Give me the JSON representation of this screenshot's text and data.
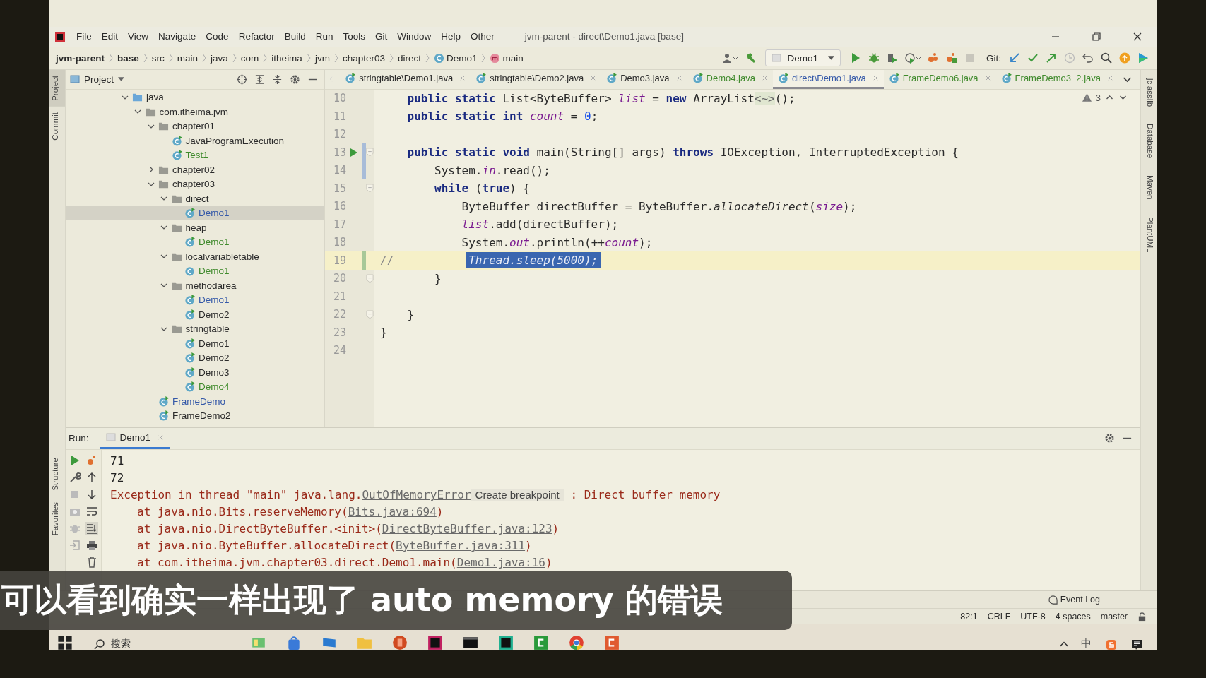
{
  "window": {
    "title": "jvm-parent - direct\\Demo1.java [base]"
  },
  "menu": [
    "File",
    "Edit",
    "View",
    "Navigate",
    "Code",
    "Refactor",
    "Build",
    "Run",
    "Tools",
    "Git",
    "Window",
    "Help",
    "Other"
  ],
  "breadcrumbs": [
    {
      "label": "jvm-parent",
      "kind": "text",
      "bold": true
    },
    {
      "label": "base",
      "kind": "text",
      "bold": true
    },
    {
      "label": "src",
      "kind": "text",
      "bold": false
    },
    {
      "label": "main",
      "kind": "text",
      "bold": false
    },
    {
      "label": "java",
      "kind": "text",
      "bold": false
    },
    {
      "label": "com",
      "kind": "text",
      "bold": false
    },
    {
      "label": "itheima",
      "kind": "text",
      "bold": false
    },
    {
      "label": "jvm",
      "kind": "text",
      "bold": false
    },
    {
      "label": "chapter03",
      "kind": "text",
      "bold": false
    },
    {
      "label": "direct",
      "kind": "text",
      "bold": false
    },
    {
      "label": "Demo1",
      "kind": "class",
      "bold": false
    },
    {
      "label": "main",
      "kind": "method",
      "bold": false
    }
  ],
  "toolbar": {
    "run_config": "Demo1",
    "git_label": "Git:"
  },
  "left_strip": {
    "top": [
      {
        "label": "Project",
        "selected": true
      },
      {
        "label": "Commit",
        "selected": false
      }
    ],
    "bottom": [
      {
        "label": "Structure",
        "selected": false
      },
      {
        "label": "Favorites",
        "selected": false
      }
    ]
  },
  "right_strip": [
    "jclasslib",
    "Database",
    "Maven",
    "PlantUML"
  ],
  "project_panel": {
    "title": "Project",
    "tree": [
      {
        "label": "java",
        "kind": "source_root",
        "expanded": true,
        "selected": false,
        "children": [
          {
            "label": "com.itheima.jvm",
            "kind": "package",
            "expanded": true,
            "selected": false,
            "children": [
              {
                "label": "chapter01",
                "kind": "package",
                "expanded": true,
                "selected": false,
                "children": [
                  {
                    "label": "JavaProgramExecution",
                    "kind": "class",
                    "runnable": true,
                    "selected": false,
                    "color": "#2b2b2b"
                  },
                  {
                    "label": "Test1",
                    "kind": "class",
                    "runnable": true,
                    "selected": false,
                    "color": "#3f8a2c"
                  }
                ]
              },
              {
                "label": "chapter02",
                "kind": "package",
                "expanded": false,
                "selected": false
              },
              {
                "label": "chapter03",
                "kind": "package",
                "expanded": true,
                "selected": false,
                "children": [
                  {
                    "label": "direct",
                    "kind": "package",
                    "expanded": true,
                    "selected": false,
                    "children": [
                      {
                        "label": "Demo1",
                        "kind": "class",
                        "runnable": true,
                        "selected": true,
                        "color": "#3458a8"
                      }
                    ]
                  },
                  {
                    "label": "heap",
                    "kind": "package",
                    "expanded": true,
                    "selected": false,
                    "children": [
                      {
                        "label": "Demo1",
                        "kind": "class",
                        "runnable": true,
                        "selected": false,
                        "color": "#3f8a2c"
                      }
                    ]
                  },
                  {
                    "label": "localvariabletable",
                    "kind": "package",
                    "expanded": true,
                    "selected": false,
                    "children": [
                      {
                        "label": "Demo1",
                        "kind": "class",
                        "runnable": false,
                        "selected": false,
                        "color": "#3f8a2c"
                      }
                    ]
                  },
                  {
                    "label": "methodarea",
                    "kind": "package",
                    "expanded": true,
                    "selected": false,
                    "children": [
                      {
                        "label": "Demo1",
                        "kind": "class",
                        "runnable": true,
                        "selected": false,
                        "color": "#3458a8"
                      },
                      {
                        "label": "Demo2",
                        "kind": "class",
                        "runnable": true,
                        "selected": false,
                        "color": "#2b2b2b"
                      }
                    ]
                  },
                  {
                    "label": "stringtable",
                    "kind": "package",
                    "expanded": true,
                    "selected": false,
                    "children": [
                      {
                        "label": "Demo1",
                        "kind": "class",
                        "runnable": true,
                        "selected": false,
                        "color": "#2b2b2b"
                      },
                      {
                        "label": "Demo2",
                        "kind": "class",
                        "runnable": true,
                        "selected": false,
                        "color": "#2b2b2b"
                      },
                      {
                        "label": "Demo3",
                        "kind": "class",
                        "runnable": true,
                        "selected": false,
                        "color": "#2b2b2b"
                      },
                      {
                        "label": "Demo4",
                        "kind": "class",
                        "runnable": true,
                        "selected": false,
                        "color": "#3f8a2c"
                      }
                    ]
                  }
                ]
              },
              {
                "label": "FrameDemo",
                "kind": "class",
                "runnable": true,
                "selected": false,
                "color": "#3458a8"
              },
              {
                "label": "FrameDemo2",
                "kind": "class",
                "runnable": true,
                "selected": false,
                "color": "#2b2b2b"
              }
            ]
          }
        ]
      }
    ]
  },
  "editor_tabs": [
    {
      "label": "stringtable\\Demo1.java",
      "selected": false,
      "color": "#2b2b2b"
    },
    {
      "label": "stringtable\\Demo2.java",
      "selected": false,
      "color": "#2b2b2b"
    },
    {
      "label": "Demo3.java",
      "selected": false,
      "color": "#2b2b2b"
    },
    {
      "label": "Demo4.java",
      "selected": false,
      "color": "#3f8a2c"
    },
    {
      "label": "direct\\Demo1.java",
      "selected": true,
      "color": "#3458a8"
    },
    {
      "label": "FrameDemo6.java",
      "selected": false,
      "color": "#3f8a2c"
    },
    {
      "label": "FrameDemo3_2.java",
      "selected": false,
      "color": "#3f8a2c"
    }
  ],
  "editor": {
    "warnings": "3",
    "lines": [
      {
        "number": "10",
        "tokens": [
          {
            "kind": "kw",
            "text": "    public static "
          },
          {
            "kind": "plain",
            "text": "List<ByteBuffer> "
          },
          {
            "kind": "field",
            "text": "list"
          },
          {
            "kind": "plain",
            "text": " = "
          },
          {
            "kind": "kw",
            "text": "new "
          },
          {
            "kind": "plain",
            "text": "ArrayList"
          },
          {
            "kind": "fold",
            "text": "<~>"
          },
          {
            "kind": "plain",
            "text": "();"
          }
        ]
      },
      {
        "number": "11",
        "tokens": [
          {
            "kind": "kw",
            "text": "    public static int "
          },
          {
            "kind": "field",
            "text": "count"
          },
          {
            "kind": "plain",
            "text": " = "
          },
          {
            "kind": "num",
            "text": "0"
          },
          {
            "kind": "plain",
            "text": ";"
          }
        ]
      },
      {
        "number": "12"
      },
      {
        "number": "13",
        "run": true,
        "fold": true,
        "color": "#a8bcd8",
        "tokens": [
          {
            "kind": "kw",
            "text": "    public static void "
          },
          {
            "kind": "plain",
            "text": "main(String[] args) "
          },
          {
            "kind": "kw",
            "text": "throws "
          },
          {
            "kind": "plain",
            "text": "IOException, InterruptedException {"
          }
        ]
      },
      {
        "number": "14",
        "color": "#a8bcd8",
        "tokens": [
          {
            "kind": "plain",
            "text": "        System."
          },
          {
            "kind": "field",
            "text": "in"
          },
          {
            "kind": "plain",
            "text": ".read();"
          }
        ]
      },
      {
        "number": "15",
        "fold": true,
        "tokens": [
          {
            "kind": "kw",
            "text": "        while "
          },
          {
            "kind": "plain",
            "text": "("
          },
          {
            "kind": "kw",
            "text": "true"
          },
          {
            "kind": "plain",
            "text": ") {"
          }
        ]
      },
      {
        "number": "16",
        "tokens": [
          {
            "kind": "plain",
            "text": "            ByteBuffer directBuffer = ByteBuffer."
          },
          {
            "kind": "method",
            "text": "allocateDirect"
          },
          {
            "kind": "plain",
            "text": "("
          },
          {
            "kind": "field",
            "text": "size"
          },
          {
            "kind": "plain",
            "text": ");"
          }
        ]
      },
      {
        "number": "17",
        "tokens": [
          {
            "kind": "field",
            "text": "            list"
          },
          {
            "kind": "plain",
            "text": ".add(directBuffer);"
          }
        ]
      },
      {
        "number": "18",
        "tokens": [
          {
            "kind": "plain",
            "text": "            System."
          },
          {
            "kind": "field",
            "text": "out"
          },
          {
            "kind": "plain",
            "text": ".println(++"
          },
          {
            "kind": "field",
            "text": "count"
          },
          {
            "kind": "plain",
            "text": ");"
          }
        ]
      },
      {
        "number": "19",
        "current": true,
        "color": "#a8c898",
        "tokens": [
          {
            "kind": "comment",
            "text": "//           "
          },
          {
            "kind": "selected",
            "text": "Thread.sleep(5000);"
          }
        ]
      },
      {
        "number": "20",
        "fold": true,
        "tokens": [
          {
            "kind": "plain",
            "text": "        }"
          }
        ]
      },
      {
        "number": "21"
      },
      {
        "number": "22",
        "fold": true,
        "tokens": [
          {
            "kind": "plain",
            "text": "    }"
          }
        ]
      },
      {
        "number": "23",
        "tokens": [
          {
            "kind": "plain",
            "text": "}"
          }
        ]
      },
      {
        "number": "24"
      }
    ]
  },
  "run_panel": {
    "label": "Run:",
    "tab": "Demo1",
    "output": [
      {
        "kind": "out",
        "segments": [
          {
            "kind": "text",
            "text": "71"
          }
        ]
      },
      {
        "kind": "out",
        "segments": [
          {
            "kind": "text",
            "text": "72"
          }
        ]
      },
      {
        "kind": "error",
        "segments": [
          {
            "kind": "text",
            "text": "Exception in thread \"main\" java.lang."
          },
          {
            "kind": "link",
            "text": "OutOfMemoryError"
          },
          {
            "kind": "hint",
            "text": "Create breakpoint"
          },
          {
            "kind": "text",
            "text": " : Direct buffer memory"
          }
        ]
      },
      {
        "kind": "stack",
        "segments": [
          {
            "kind": "text",
            "text": "at java.nio.Bits.reserveMemory("
          },
          {
            "kind": "link",
            "text": "Bits.java:694"
          },
          {
            "kind": "text",
            "text": ")"
          }
        ]
      },
      {
        "kind": "stack",
        "segments": [
          {
            "kind": "text",
            "text": "at java.nio.DirectByteBuffer.<init>("
          },
          {
            "kind": "link",
            "text": "DirectByteBuffer.java:123"
          },
          {
            "kind": "text",
            "text": ")"
          }
        ]
      },
      {
        "kind": "stack",
        "segments": [
          {
            "kind": "text",
            "text": "at java.nio.ByteBuffer.allocateDirect("
          },
          {
            "kind": "link",
            "text": "ByteBuffer.java:311"
          },
          {
            "kind": "text",
            "text": ")"
          }
        ]
      },
      {
        "kind": "stack",
        "segments": [
          {
            "kind": "text",
            "text": "at com.itheima.jvm.chapter03.direct.Demo1.main("
          },
          {
            "kind": "link",
            "text": "Demo1.java:16"
          },
          {
            "kind": "text",
            "text": ")"
          }
        ]
      }
    ]
  },
  "event_log": "Event Log",
  "status_bar": [
    "82:1",
    "CRLF",
    "UTF-8",
    "4 spaces",
    "master"
  ],
  "taskbar": {
    "search": "搜索",
    "ime": "中"
  },
  "subtitle": "可以看到确实一样出现了 auto memory 的错误"
}
